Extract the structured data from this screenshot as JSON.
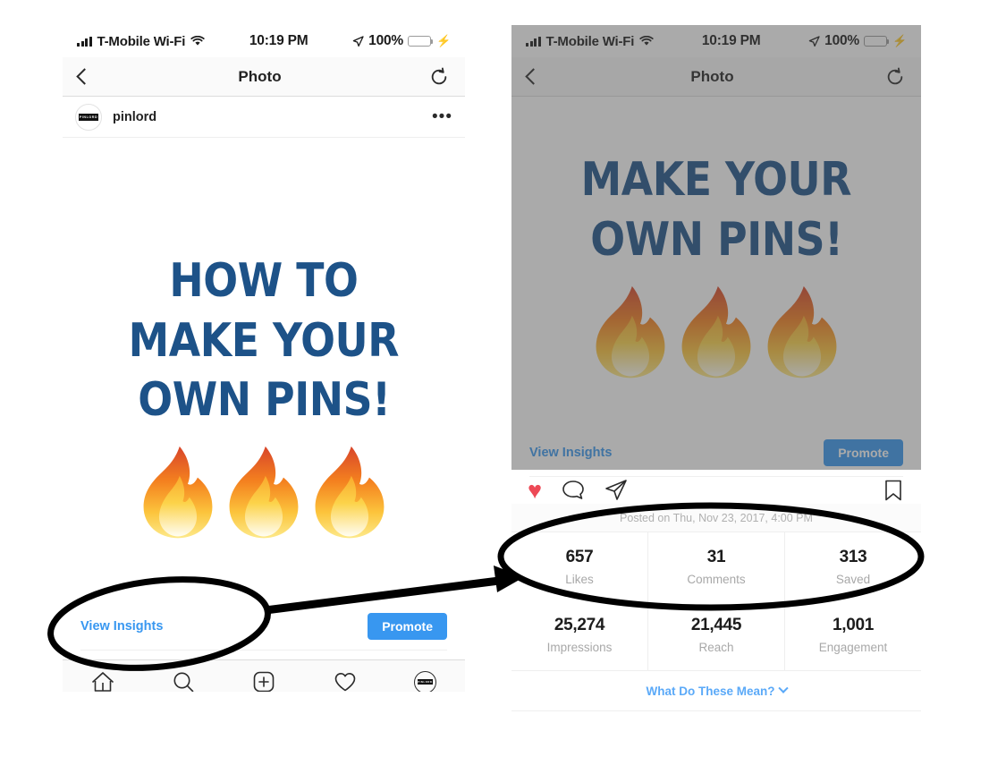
{
  "status_bar": {
    "carrier": "T-Mobile Wi-Fi",
    "time": "10:19 PM",
    "battery_pct": "100%",
    "signal_icon": "signal-bars-icon",
    "wifi_icon": "wifi-icon",
    "location_icon": "location-arrow-icon",
    "battery_icon": "battery-icon",
    "charging_icon": "lightning-bolt-icon"
  },
  "nav_bar": {
    "title": "Photo",
    "back_icon": "chevron-left-icon",
    "refresh_icon": "refresh-icon"
  },
  "post": {
    "username": "pinlord",
    "avatar_text": "PINLORD",
    "more_icon": "ellipsis-icon",
    "headline_lines": [
      "HOW TO",
      "MAKE YOUR",
      "OWN PINS!"
    ],
    "headline_color": "#1d5288",
    "emoji": "fire-emoji",
    "emoji_count": 3
  },
  "action_strip": {
    "view_insights_label": "View Insights",
    "promote_label": "Promote",
    "accent_color": "#3897f0"
  },
  "post_actions": {
    "like_icon": "heart-filled-icon",
    "comment_icon": "comment-bubble-icon",
    "share_icon": "paper-plane-icon",
    "save_icon": "bookmark-icon",
    "like_color": "#ed4956"
  },
  "tab_bar": {
    "items": [
      {
        "name": "home",
        "icon": "home-icon"
      },
      {
        "name": "search",
        "icon": "search-icon"
      },
      {
        "name": "add",
        "icon": "plus-square-icon"
      },
      {
        "name": "activity",
        "icon": "heart-outline-icon",
        "badge": true
      },
      {
        "name": "profile",
        "icon": "profile-avatar-icon"
      }
    ]
  },
  "insights": {
    "posted_on": "Posted on Thu, Nov 23, 2017, 4:00 PM",
    "row_primary": [
      {
        "value": "657",
        "label": "Likes"
      },
      {
        "value": "31",
        "label": "Comments"
      },
      {
        "value": "313",
        "label": "Saved"
      }
    ],
    "row_secondary": [
      {
        "value": "25,274",
        "label": "Impressions"
      },
      {
        "value": "21,445",
        "label": "Reach"
      },
      {
        "value": "1,001",
        "label": "Engagement"
      }
    ],
    "what_do_these_mean": "What Do These Mean?",
    "mean_chevron_icon": "chevron-down-icon",
    "link_color": "#5aa9f8"
  },
  "annotation": {
    "left_ellipse_name": "view-insights-highlight",
    "right_ellipse_name": "stats-highlight",
    "arrow_name": "pointer-arrow",
    "stroke_color": "#000000"
  }
}
